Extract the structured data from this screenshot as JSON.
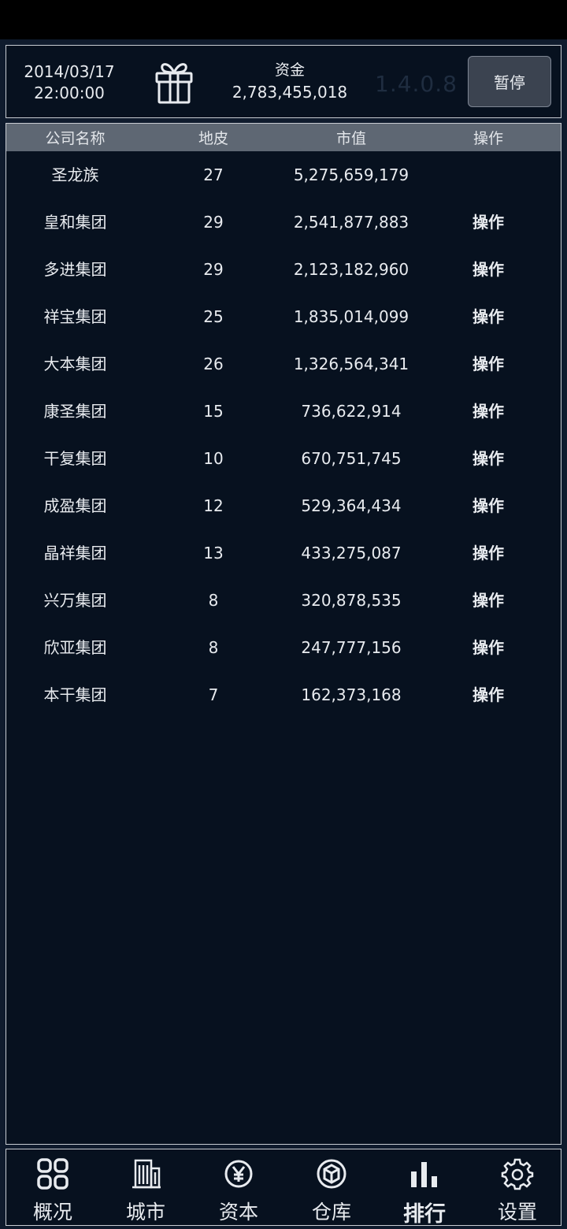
{
  "header": {
    "date": "2014/03/17",
    "time": "22:00:00",
    "funds_label": "资金",
    "funds_value": "2,783,455,018",
    "version": "1.4.0.8",
    "pause_label": "暂停"
  },
  "table": {
    "columns": [
      "公司名称",
      "地皮",
      "市值",
      "操作"
    ],
    "rows": [
      {
        "name": "圣龙族",
        "land": "27",
        "value": "5,275,659,179",
        "action": ""
      },
      {
        "name": "皇和集团",
        "land": "29",
        "value": "2,541,877,883",
        "action": "操作"
      },
      {
        "name": "多进集团",
        "land": "29",
        "value": "2,123,182,960",
        "action": "操作"
      },
      {
        "name": "祥宝集团",
        "land": "25",
        "value": "1,835,014,099",
        "action": "操作"
      },
      {
        "name": "大本集团",
        "land": "26",
        "value": "1,326,564,341",
        "action": "操作"
      },
      {
        "name": "康圣集团",
        "land": "15",
        "value": "736,622,914",
        "action": "操作"
      },
      {
        "name": "干复集团",
        "land": "10",
        "value": "670,751,745",
        "action": "操作"
      },
      {
        "name": "成盈集团",
        "land": "12",
        "value": "529,364,434",
        "action": "操作"
      },
      {
        "name": "晶祥集团",
        "land": "13",
        "value": "433,275,087",
        "action": "操作"
      },
      {
        "name": "兴万集团",
        "land": "8",
        "value": "320,878,535",
        "action": "操作"
      },
      {
        "name": "欣亚集团",
        "land": "8",
        "value": "247,777,156",
        "action": "操作"
      },
      {
        "name": "本干集团",
        "land": "7",
        "value": "162,373,168",
        "action": "操作"
      }
    ]
  },
  "nav": {
    "items": [
      {
        "label": "概况",
        "icon": "grid-icon"
      },
      {
        "label": "城市",
        "icon": "building-icon"
      },
      {
        "label": "资本",
        "icon": "yen-icon"
      },
      {
        "label": "仓库",
        "icon": "box-icon"
      },
      {
        "label": "排行",
        "icon": "bar-chart-icon"
      },
      {
        "label": "设置",
        "icon": "gear-icon"
      }
    ],
    "active": "排行"
  },
  "colors": {
    "background": "#07111f",
    "header_row": "#5e6773",
    "button": "#3b4350"
  }
}
